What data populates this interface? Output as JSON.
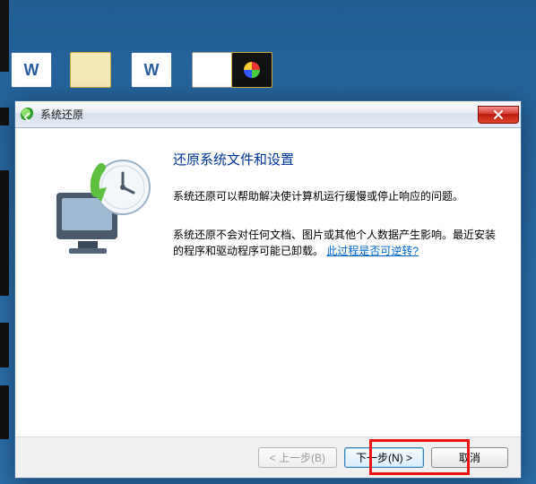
{
  "desktop": {
    "label_blur": ""
  },
  "window": {
    "title": "系统还原",
    "close_aria": "close"
  },
  "content": {
    "heading": "还原系统文件和设置",
    "para1": "系统还原可以帮助解决使计算机运行缓慢或停止响应的问题。",
    "para2_a": "系统还原不会对任何文档、图片或其他个人数据产生影响。最近安装的程序和驱动程序可能已卸载。",
    "para2_link": "此过程是否可逆转?"
  },
  "footer": {
    "back": "< 上一步(B)",
    "next": "下一步(N) >",
    "cancel": "取消"
  }
}
